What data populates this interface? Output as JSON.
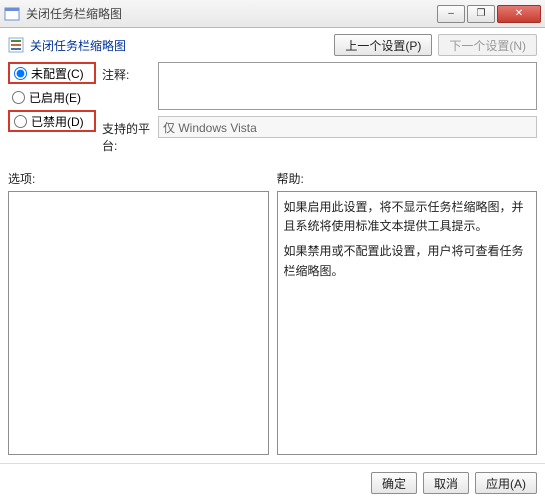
{
  "window": {
    "title": "关闭任务栏缩略图"
  },
  "winbtns": {
    "min": "–",
    "restore": "❐",
    "close": "✕"
  },
  "policy": {
    "title": "关闭任务栏缩略图"
  },
  "nav": {
    "prev": "上一个设置(P)",
    "next": "下一个设置(N)"
  },
  "radios": {
    "notconfigured": "未配置(C)",
    "enabled": "已启用(E)",
    "disabled": "已禁用(D)"
  },
  "fields": {
    "comment_label": "注释:",
    "comment_value": "",
    "platform_label": "支持的平台:",
    "platform_value": "仅 Windows Vista"
  },
  "sections": {
    "options": "选项:",
    "help": "帮助:"
  },
  "help_text": {
    "p1": "如果启用此设置，将不显示任务栏缩略图，并且系统将使用标准文本提供工具提示。",
    "p2": "如果禁用或不配置此设置，用户将可查看任务栏缩略图。"
  },
  "footer": {
    "ok": "确定",
    "cancel": "取消",
    "apply": "应用(A)"
  }
}
